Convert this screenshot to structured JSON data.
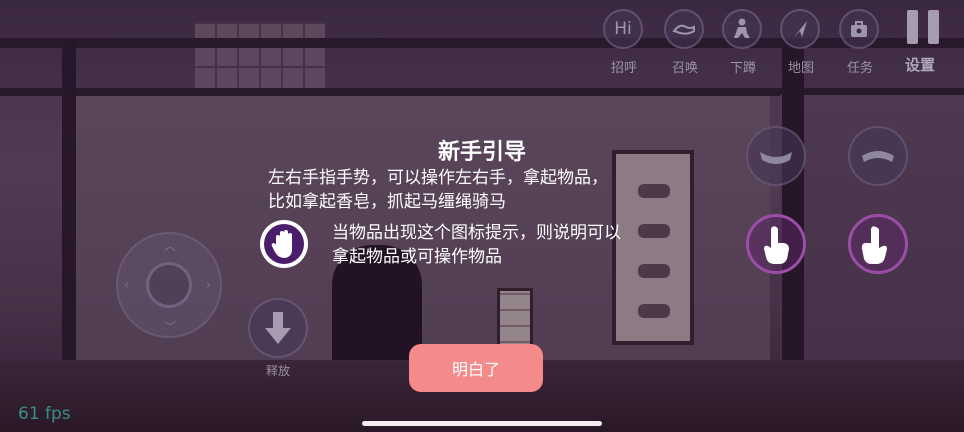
{
  "menu": {
    "items": [
      {
        "icon_text": "Hi",
        "label": "招呼",
        "icon": "hi-icon"
      },
      {
        "icon_text": "",
        "label": "召唤",
        "icon": "summon-hand-icon"
      },
      {
        "icon_text": "",
        "label": "下蹲",
        "icon": "crouch-icon"
      },
      {
        "icon_text": "",
        "label": "地图",
        "icon": "map-arrow-icon"
      },
      {
        "icon_text": "",
        "label": "任务",
        "icon": "task-bag-icon"
      }
    ],
    "settings_label": "设置"
  },
  "tutorial": {
    "title": "新手引导",
    "line1": "左右手指手势，可以操作左右手，拿起物品，",
    "line2": "比如拿起香皂，抓起马缰绳骑马",
    "line3": "当物品出现这个图标提示，则说明可以",
    "line4": "拿起物品或可操作物品",
    "confirm_label": "明白了"
  },
  "controls": {
    "release_label": "释放"
  },
  "fps_text": "61 fps",
  "colors": {
    "confirm_button": "#f58a8a",
    "hand_button_ring": "#9a4ea6",
    "grab_icon_bg": "#4a1d6a",
    "fps_text": "#3a8f82"
  }
}
